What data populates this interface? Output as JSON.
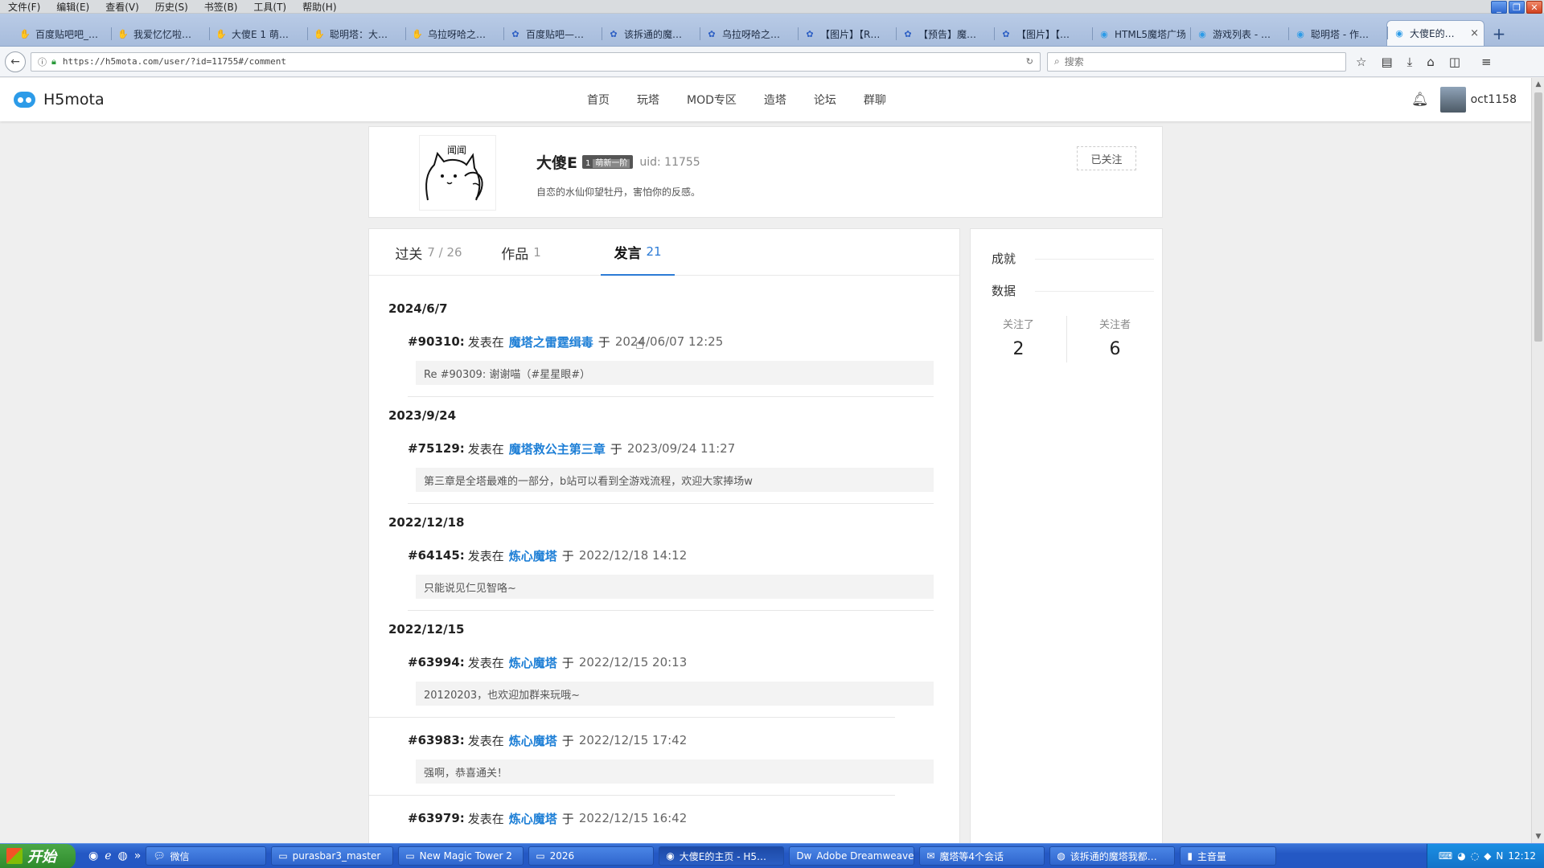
{
  "menubar": [
    "文件(F)",
    "编辑(E)",
    "查看(V)",
    "历史(S)",
    "书签(B)",
    "工具(T)",
    "帮助(H)"
  ],
  "window_controls": [
    "_",
    "❐",
    "✕"
  ],
  "browser_tabs": [
    {
      "icon": "paw-icon",
      "title": "百度贴吧吧_…"
    },
    {
      "icon": "paw-icon",
      "title": "我爱忆忆啦…"
    },
    {
      "icon": "paw-icon",
      "title": "大傻E 1 萌…"
    },
    {
      "icon": "paw-icon",
      "title": "聪明塔：大…"
    },
    {
      "icon": "paw-icon",
      "title": "乌拉呀哈之…"
    },
    {
      "icon": "bear-icon",
      "title": "百度贴吧—…"
    },
    {
      "icon": "bear-icon",
      "title": "该拆通的魔…"
    },
    {
      "icon": "bear-icon",
      "title": "乌拉呀哈之…"
    },
    {
      "icon": "bear-icon",
      "title": "【图片】【R…"
    },
    {
      "icon": "bear-icon",
      "title": "【预告】魔…"
    },
    {
      "icon": "bear-icon",
      "title": "【图片】【…"
    },
    {
      "icon": "site-icon",
      "title": "HTML5魔塔广场"
    },
    {
      "icon": "site-icon",
      "title": "游戏列表 - …"
    },
    {
      "icon": "site-icon",
      "title": "聪明塔 - 作…"
    }
  ],
  "active_tab": {
    "icon": "site-icon",
    "title": "大傻E的…",
    "close": "×"
  },
  "new_tab": "+",
  "address_bar": {
    "url": "https://h5mota.com/user/?id=11755#/comment"
  },
  "search_bar": {
    "placeholder": "搜索"
  },
  "site": {
    "logo_text": "H5mota",
    "nav": [
      "首页",
      "玩塔",
      "MOD专区",
      "造塔",
      "论坛",
      "群聊"
    ],
    "username": "oct1158"
  },
  "profile": {
    "name": "大傻E",
    "level_num": "1",
    "level_title": "萌新一阶",
    "uid": "uid: 11755",
    "bio": "自恋的水仙仰望牡丹，害怕你的反感。",
    "follow_button": "已关注",
    "avatar_caption": "闻闻"
  },
  "tabs": [
    {
      "label": "过关",
      "count": "7 / 26"
    },
    {
      "label": "作品",
      "count": "1"
    },
    {
      "label": "发言",
      "count": "21"
    }
  ],
  "feed": [
    {
      "date": "2024/6/7",
      "posts": [
        {
          "id": "#90310:",
          "prefix": "发表在",
          "tower": "魔塔之雷霆缉毒",
          "mid": "于",
          "time": "2024/06/07 12:25",
          "body": "Re #90309: 谢谢喵（#星星眼#）"
        }
      ]
    },
    {
      "date": "2023/9/24",
      "posts": [
        {
          "id": "#75129:",
          "prefix": "发表在",
          "tower": "魔塔救公主第三章",
          "mid": "于",
          "time": "2023/09/24 11:27",
          "body": "第三章是全塔最难的一部分，b站可以看到全游戏流程，欢迎大家捧场w"
        }
      ]
    },
    {
      "date": "2022/12/18",
      "posts": [
        {
          "id": "#64145:",
          "prefix": "发表在",
          "tower": "炼心魔塔",
          "mid": "于",
          "time": "2022/12/18 14:12",
          "body": "只能说见仁见智咯~"
        }
      ]
    },
    {
      "date": "2022/12/15",
      "posts": [
        {
          "id": "#63994:",
          "prefix": "发表在",
          "tower": "炼心魔塔",
          "mid": "于",
          "time": "2022/12/15 20:13",
          "body": "20120203，也欢迎加群来玩哦~"
        },
        {
          "id": "#63983:",
          "prefix": "发表在",
          "tower": "炼心魔塔",
          "mid": "于",
          "time": "2022/12/15 17:42",
          "body": "强啊，恭喜通关！"
        },
        {
          "id": "#63979:",
          "prefix": "发表在",
          "tower": "炼心魔塔",
          "mid": "于",
          "time": "2022/12/15 16:42",
          "body": ""
        }
      ]
    }
  ],
  "sidebar": {
    "achievements": "成就",
    "data": "数据",
    "following_label": "关注了",
    "following_value": "2",
    "followers_label": "关注者",
    "followers_value": "6"
  },
  "taskbar": {
    "start": "开始",
    "items": [
      {
        "label": "微信",
        "active": false
      },
      {
        "label": "purasbar3_master",
        "active": false
      },
      {
        "label": "New Magic Tower 2",
        "active": false
      },
      {
        "label": "2026",
        "active": false
      },
      {
        "label": "大傻E的主页 - H5…",
        "active": true
      },
      {
        "label": "Adobe Dreamweave…",
        "active": false
      },
      {
        "label": "魔塔等4个会话",
        "active": false
      },
      {
        "label": "该拆通的魔塔我都…",
        "active": false
      },
      {
        "label": "主音量",
        "active": false
      }
    ],
    "clock": "12:12"
  }
}
